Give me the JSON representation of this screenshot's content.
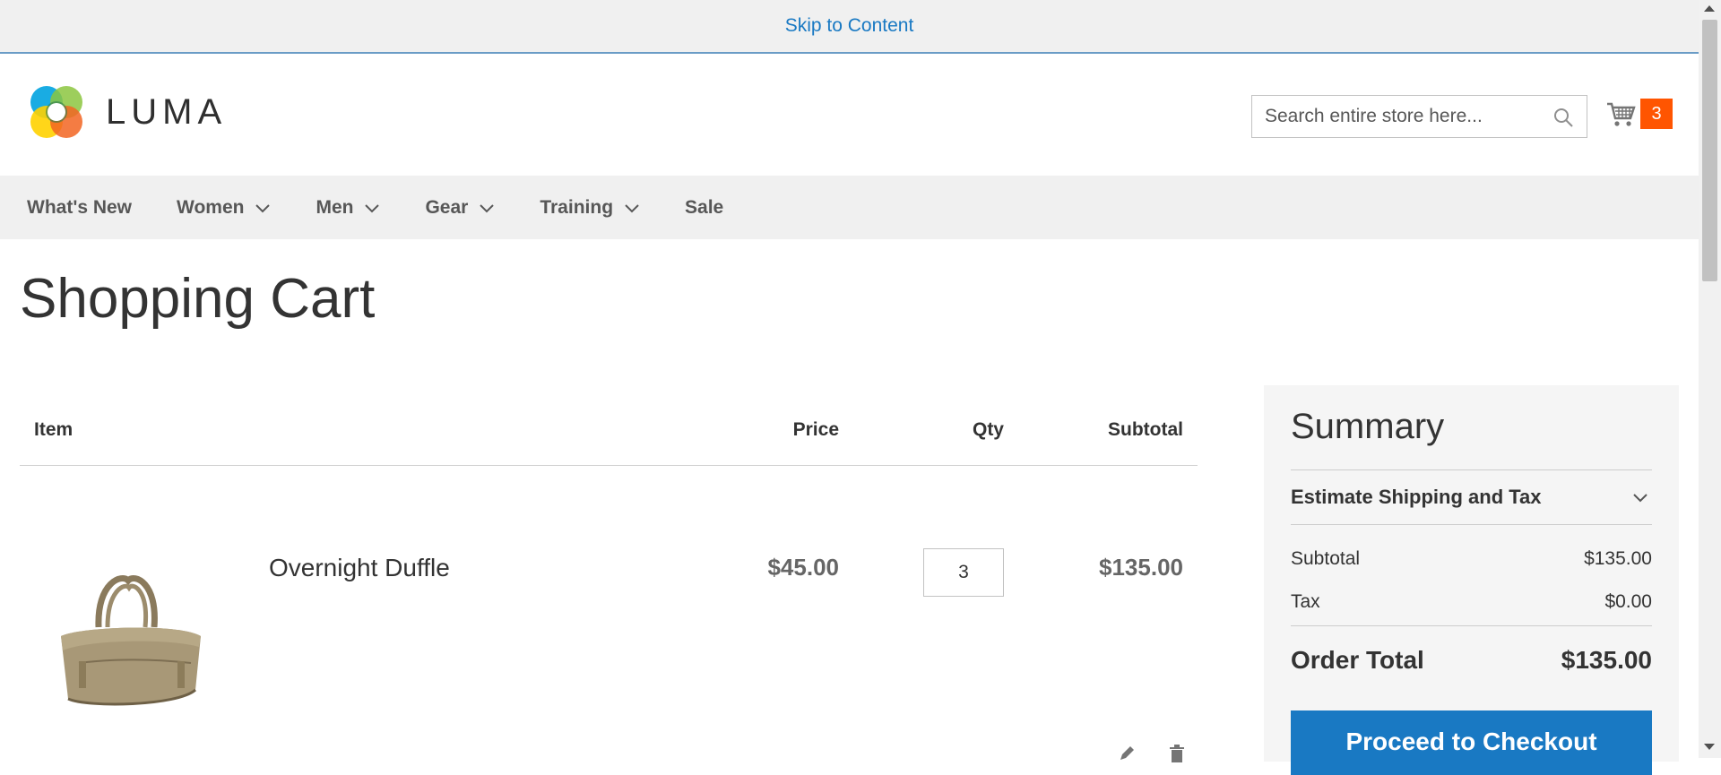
{
  "skip_link": "Skip to Content",
  "brand": {
    "name": "LUMA"
  },
  "search": {
    "placeholder": "Search entire store here...",
    "value": ""
  },
  "minicart": {
    "count": "3"
  },
  "nav": {
    "items": [
      {
        "label": "What's New",
        "has_submenu": false
      },
      {
        "label": "Women",
        "has_submenu": true
      },
      {
        "label": "Men",
        "has_submenu": true
      },
      {
        "label": "Gear",
        "has_submenu": true
      },
      {
        "label": "Training",
        "has_submenu": true
      },
      {
        "label": "Sale",
        "has_submenu": false
      }
    ]
  },
  "page_title": "Shopping Cart",
  "cart": {
    "headers": {
      "item": "Item",
      "price": "Price",
      "qty": "Qty",
      "subtotal": "Subtotal"
    },
    "items": [
      {
        "name": "Overnight Duffle",
        "price": "$45.00",
        "qty": "3",
        "subtotal": "$135.00"
      }
    ]
  },
  "summary": {
    "title": "Summary",
    "estimate_label": "Estimate Shipping and Tax",
    "subtotal_label": "Subtotal",
    "subtotal_value": "$135.00",
    "tax_label": "Tax",
    "tax_value": "$0.00",
    "total_label": "Order Total",
    "total_value": "$135.00",
    "checkout_label": "Proceed to Checkout"
  },
  "colors": {
    "accent": "#1979c3",
    "cart_badge": "#ff5501",
    "nav_bg": "#f0f0f0"
  }
}
